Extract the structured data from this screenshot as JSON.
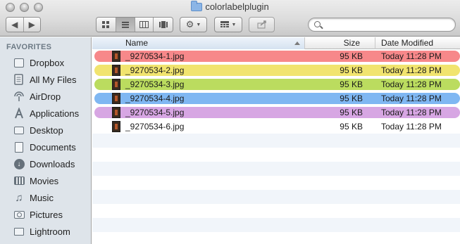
{
  "window": {
    "title": "colorlabelplugin",
    "title_icon": "folder-icon"
  },
  "toolbar": {
    "nav": [
      "back-arrow-icon",
      "forward-arrow-icon"
    ],
    "view_modes": [
      "icon-view-icon",
      "list-view-icon",
      "column-view-icon",
      "coverflow-view-icon"
    ],
    "active_view": "list",
    "action_icon": "gear-icon",
    "arrange_icon": "arrange-grid-icon",
    "share_icon": "share-icon",
    "search": {
      "value": "",
      "placeholder": ""
    }
  },
  "sidebar": {
    "header": "FAVORITES",
    "items": [
      {
        "label": "Dropbox",
        "icon": "dropbox-box-icon"
      },
      {
        "label": "All My Files",
        "icon": "all-my-files-icon"
      },
      {
        "label": "AirDrop",
        "icon": "airdrop-icon"
      },
      {
        "label": "Applications",
        "icon": "applications-icon"
      },
      {
        "label": "Desktop",
        "icon": "desktop-icon"
      },
      {
        "label": "Documents",
        "icon": "documents-icon"
      },
      {
        "label": "Downloads",
        "icon": "downloads-icon"
      },
      {
        "label": "Movies",
        "icon": "movies-icon"
      },
      {
        "label": "Music",
        "icon": "music-icon"
      },
      {
        "label": "Pictures",
        "icon": "pictures-icon"
      },
      {
        "label": "Lightroom",
        "icon": "folder-icon"
      }
    ]
  },
  "list": {
    "columns": {
      "name": "Name",
      "size": "Size",
      "date": "Date Modified"
    },
    "sorted_by": "name-ascending",
    "files": [
      {
        "name": "_9270534-1.jpg",
        "size": "95 KB",
        "modified": "Today 11:28 PM",
        "label_color": "#f7888a"
      },
      {
        "name": "_9270534-2.jpg",
        "size": "95 KB",
        "modified": "Today 11:28 PM",
        "label_color": "#f1e46f"
      },
      {
        "name": "_9270534-3.jpg",
        "size": "95 KB",
        "modified": "Today 11:28 PM",
        "label_color": "#bbdc5f"
      },
      {
        "name": "_9270534-4.jpg",
        "size": "95 KB",
        "modified": "Today 11:28 PM",
        "label_color": "#7fb7f2"
      },
      {
        "name": "_9270534-5.jpg",
        "size": "95 KB",
        "modified": "Today 11:28 PM",
        "label_color": "#d7a6e3"
      },
      {
        "name": "_9270534-6.jpg",
        "size": "95 KB",
        "modified": "Today 11:28 PM",
        "label_color": ""
      }
    ]
  }
}
